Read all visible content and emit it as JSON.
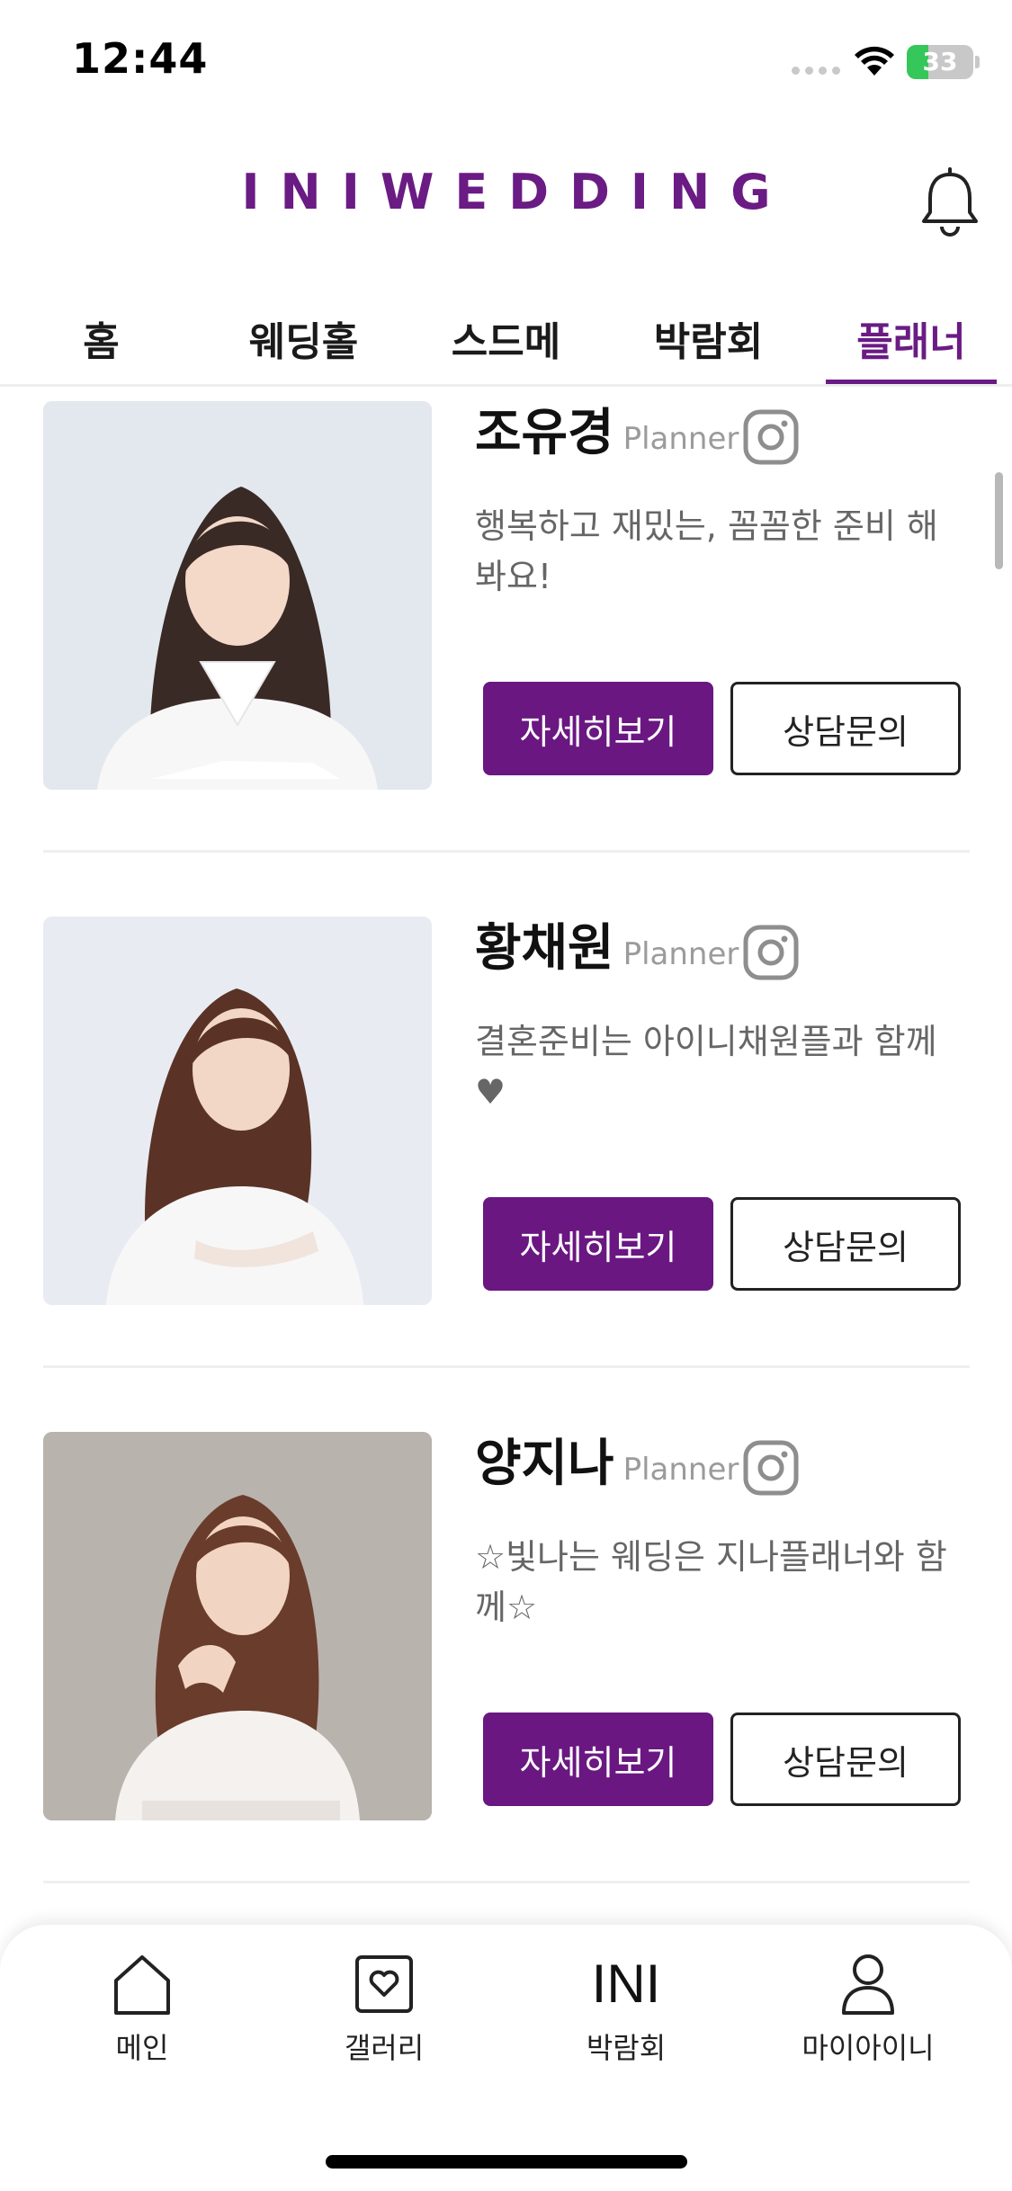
{
  "status_bar": {
    "time": "12:44",
    "battery": "33",
    "battery_level": 0.33
  },
  "header": {
    "brand": "INIWEDDING"
  },
  "tabs": [
    {
      "label": "홈"
    },
    {
      "label": "웨딩홀"
    },
    {
      "label": "스드메"
    },
    {
      "label": "박람회"
    },
    {
      "label": "플래너",
      "active": true
    }
  ],
  "planners": [
    {
      "name": "조유경",
      "role": "Planner",
      "description": "행복하고 재밌는, 꼼꼼한 준비 해봐요!",
      "detail_label": "자세히보기",
      "consult_label": "상담문의",
      "photo_bg": "#e3e8ee"
    },
    {
      "name": "황채원",
      "role": "Planner",
      "description": "결혼준비는 아이니채원플과 함께♥",
      "detail_label": "자세히보기",
      "consult_label": "상담문의",
      "photo_bg": "#e8ecf2"
    },
    {
      "name": "양지나",
      "role": "Planner",
      "description": "☆빛나는 웨딩은 지나플래너와 함께☆",
      "detail_label": "자세히보기",
      "consult_label": "상담문의",
      "photo_bg": "#b9b3ae"
    }
  ],
  "bottom_nav": [
    {
      "label": "메인",
      "icon": "home-icon"
    },
    {
      "label": "갤러리",
      "icon": "gallery-heart-icon"
    },
    {
      "label": "박람회",
      "icon": "ini-text-icon",
      "icon_text": "INI"
    },
    {
      "label": "마이아이니",
      "icon": "person-icon"
    }
  ],
  "colors": {
    "brand": "#6a1b84",
    "button": "#6a1782",
    "text_muted": "#666666"
  }
}
